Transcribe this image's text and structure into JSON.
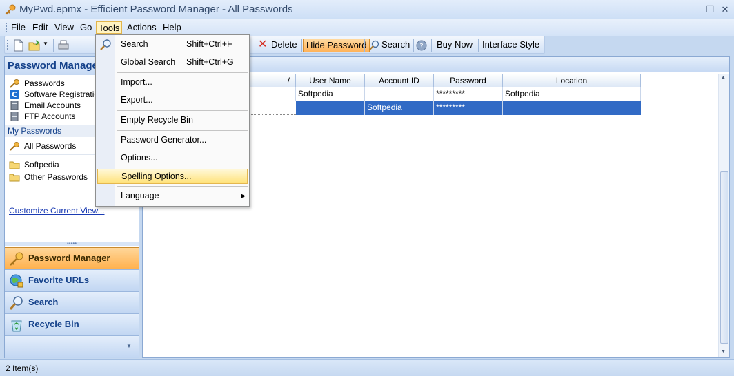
{
  "window": {
    "title": "MyPwd.epmx - Efficient Password Manager - All Passwords",
    "controls": [
      "minimize-icon",
      "restore-icon",
      "close-icon"
    ]
  },
  "menubar": {
    "file": "File",
    "edit": "Edit",
    "view": "View",
    "go": "Go",
    "tools": "Tools",
    "actions": "Actions",
    "help": "Help"
  },
  "toolbar": {
    "partial_edit": "t",
    "delete": "Delete",
    "hide_password": "Hide Password",
    "search": "Search",
    "buy_now": "Buy Now",
    "interface_style": "Interface Style"
  },
  "tools_menu": {
    "search": "Search",
    "search_shortcut": "Shift+Ctrl+F",
    "global_search": "Global Search",
    "global_search_shortcut": "Shift+Ctrl+G",
    "import": "Import...",
    "export": "Export...",
    "empty_recycle_bin": "Empty Recycle Bin",
    "password_generator": "Password Generator...",
    "options": "Options...",
    "spelling_options": "Spelling Options...",
    "language": "Language"
  },
  "left_pane": {
    "header": "Password Manager",
    "categories": [
      "Passwords",
      "Software Registration",
      "Email Accounts",
      "FTP Accounts"
    ],
    "group_label": "My Passwords",
    "all_passwords": "All Passwords",
    "folders": [
      "Softpedia",
      "Other Passwords"
    ],
    "customize": "Customize Current View...",
    "nav": [
      "Password Manager",
      "Favorite URLs",
      "Search",
      "Recycle Bin"
    ]
  },
  "grid": {
    "sort_indicator": "/",
    "columns": [
      "User Name",
      "Account ID",
      "Password",
      "Location"
    ],
    "rows": [
      {
        "user": "Softpedia",
        "account": "",
        "password": "*********",
        "location": "Softpedia"
      },
      {
        "user": "",
        "account": "Softpedia",
        "password": "*********",
        "location": ""
      }
    ]
  },
  "status": {
    "text": "2 Item(s)"
  },
  "colors": {
    "accent": "#ffb35a",
    "selection": "#316ac5",
    "header_text": "#15428b"
  }
}
